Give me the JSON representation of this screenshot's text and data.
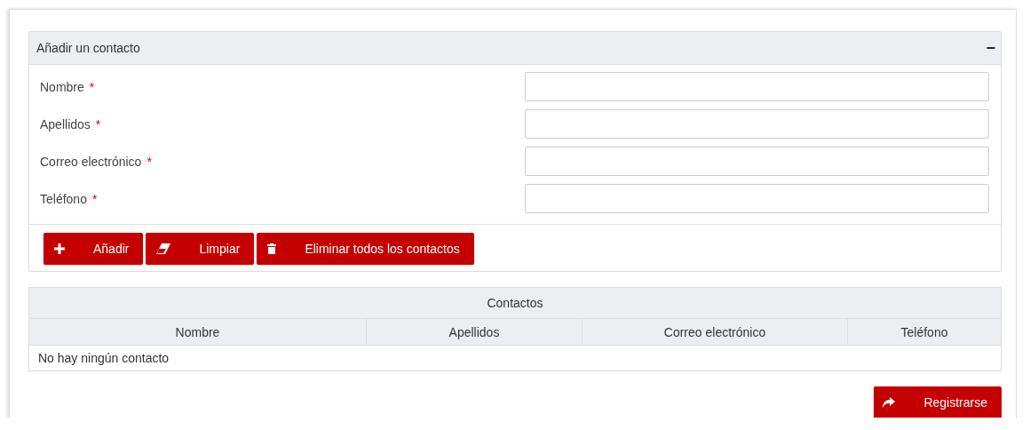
{
  "panel": {
    "title": "Añadir un contacto",
    "collapse_symbol": "−",
    "fields": [
      {
        "label": "Nombre",
        "required": true,
        "required_mark": "*"
      },
      {
        "label": "Apellidos",
        "required": true,
        "required_mark": "*"
      },
      {
        "label": "Correo electrónico",
        "required": true,
        "required_mark": "*"
      },
      {
        "label": "Teléfono",
        "required": true,
        "required_mark": "*"
      }
    ],
    "buttons": [
      {
        "label": "Añadir",
        "kind": "plus"
      },
      {
        "label": "Limpiar",
        "kind": "eraser"
      },
      {
        "label": "Eliminar todos los contactos",
        "kind": "trash"
      }
    ]
  },
  "table": {
    "title": "Contactos",
    "columns": [
      "Nombre",
      "Apellidos",
      "Correo electrónico",
      "Teléfono"
    ],
    "empty_message": "No hay ningún contacto"
  },
  "submit_button": {
    "label": "Registrarse",
    "kind": "share"
  }
}
